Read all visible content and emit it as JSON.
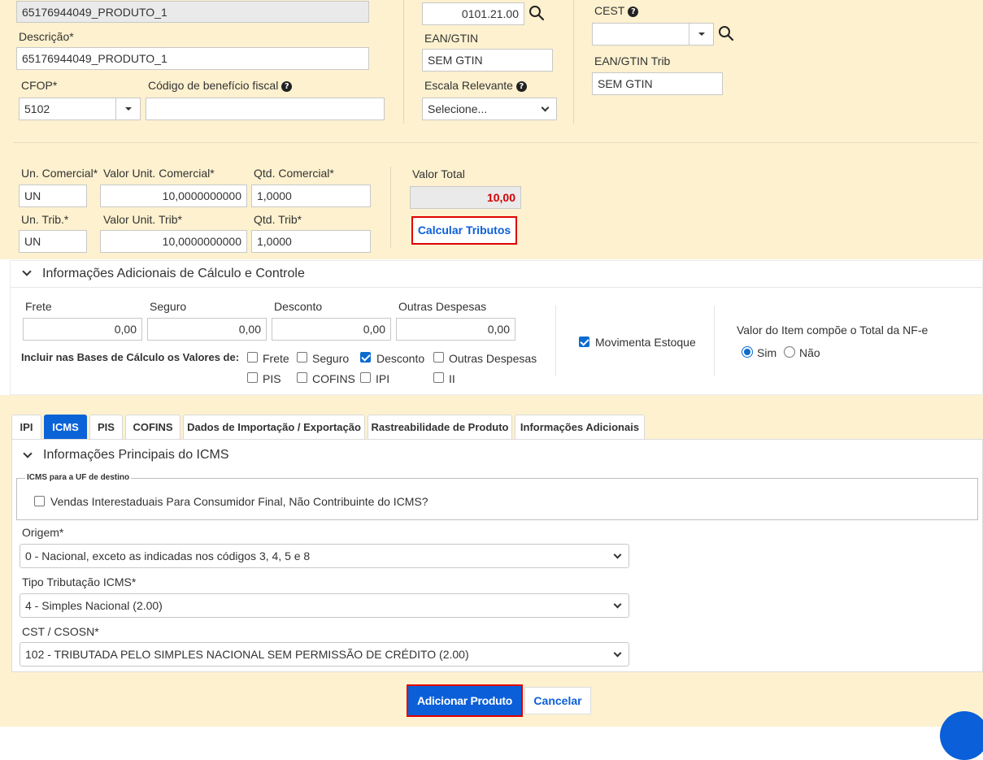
{
  "product": {
    "code_value": "65176944049_PRODUTO_1",
    "descricao_label": "Descrição*",
    "descricao_value": "65176944049_PRODUTO_1",
    "cfop_label": "CFOP*",
    "cfop_value": "5102",
    "beneficio_label": "Código de benefício fiscal",
    "ncm_value": "0101.21.00",
    "ean_label": "EAN/GTIN",
    "ean_value": "SEM GTIN",
    "escala_label": "Escala Relevante",
    "escala_value": "Selecione...",
    "cest_label": "CEST",
    "cest_value": "",
    "ean_trib_label": "EAN/GTIN Trib",
    "ean_trib_value": "SEM GTIN"
  },
  "values": {
    "un_com_label": "Un. Comercial*",
    "un_com_value": "UN",
    "vl_unit_com_label": "Valor Unit. Comercial*",
    "vl_unit_com_value": "10,0000000000",
    "qtd_com_label": "Qtd. Comercial*",
    "qtd_com_value": "1,0000",
    "un_trib_label": "Un. Trib.*",
    "un_trib_value": "UN",
    "vl_unit_trib_label": "Valor Unit. Trib*",
    "vl_unit_trib_value": "10,0000000000",
    "qtd_trib_label": "Qtd. Trib*",
    "qtd_trib_value": "1,0000",
    "valor_total_label": "Valor Total",
    "valor_total_value": "10,00",
    "calc_button": "Calcular Tributos"
  },
  "adicionais": {
    "title": "Informações Adicionais de Cálculo e Controle",
    "frete_label": "Frete",
    "frete_value": "0,00",
    "seguro_label": "Seguro",
    "seguro_value": "0,00",
    "desconto_label": "Desconto",
    "desconto_value": "0,00",
    "outras_label": "Outras Despesas",
    "outras_value": "0,00",
    "incluir_label": "Incluir nas Bases de Cálculo os Valores de:",
    "checks": [
      {
        "label": "Frete",
        "checked": false
      },
      {
        "label": "Seguro",
        "checked": false
      },
      {
        "label": "Desconto",
        "checked": true
      },
      {
        "label": "Outras Despesas",
        "checked": false
      },
      {
        "label": "PIS",
        "checked": false
      },
      {
        "label": "COFINS",
        "checked": false
      },
      {
        "label": "IPI",
        "checked": false
      },
      {
        "label": "II",
        "checked": false
      }
    ],
    "movimenta_label": "Movimenta Estoque",
    "movimenta_checked": true,
    "valor_item_label": "Valor do Item compõe o Total da NF-e",
    "sim_label": "Sim",
    "nao_label": "Não",
    "selected": "Sim"
  },
  "tabs": [
    {
      "label": "IPI",
      "active": false
    },
    {
      "label": "ICMS",
      "active": true
    },
    {
      "label": "PIS",
      "active": false
    },
    {
      "label": "COFINS",
      "active": false
    },
    {
      "label": "Dados de Importação / Exportação",
      "active": false
    },
    {
      "label": "Rastreabilidade de Produto",
      "active": false
    },
    {
      "label": "Informações Adicionais",
      "active": false
    }
  ],
  "icms": {
    "section_title": "Informações Principais do ICMS",
    "legend": "ICMS para a UF de destino",
    "vendas_label": "Vendas Interestaduais Para Consumidor Final, Não Contribuinte do ICMS?",
    "origem_label": "Origem*",
    "origem_value": "0 - Nacional, exceto as indicadas nos códigos 3, 4, 5 e 8",
    "tipo_label": "Tipo Tributação ICMS*",
    "tipo_value": "4 - Simples Nacional (2.00)",
    "cst_label": "CST / CSOSN*",
    "cst_value": "102 - TRIBUTADA PELO SIMPLES NACIONAL SEM PERMISSÃO DE CRÉDITO (2.00)"
  },
  "footer": {
    "add_button": "Adicionar Produto",
    "cancel_button": "Cancelar"
  },
  "colors": {
    "panel_bg": "#fdf1cf",
    "primary": "#0b5fd8",
    "highlight": "#e00000"
  },
  "icons": {
    "search": "search-icon",
    "help": "help-icon",
    "caret": "caret-down-icon",
    "chat": "chat-icon"
  }
}
